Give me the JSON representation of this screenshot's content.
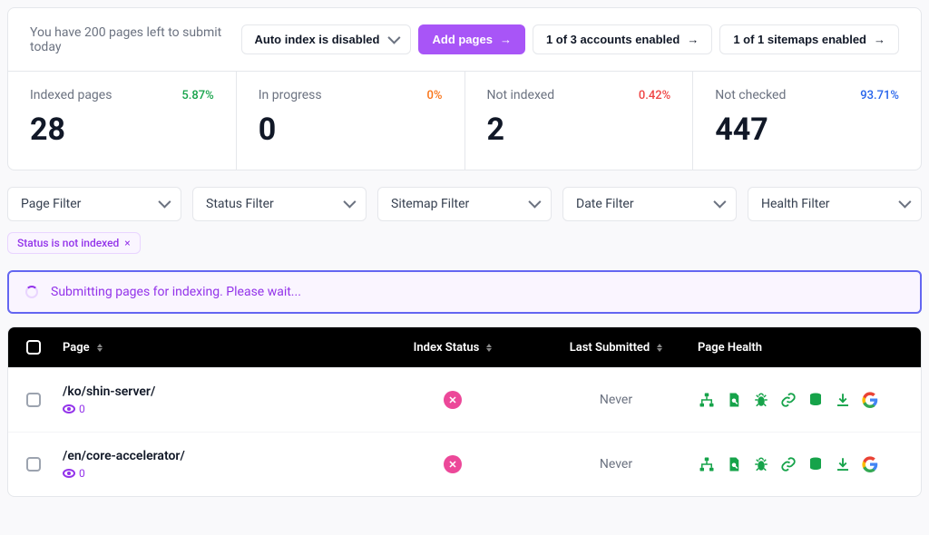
{
  "topbar": {
    "quota_msg": "You have 200 pages left to submit today",
    "auto_index_label": "Auto index is disabled",
    "add_pages_label": "Add pages",
    "accounts_label": "1 of 3 accounts enabled",
    "sitemaps_label": "1 of 1 sitemaps enabled"
  },
  "stats": {
    "indexed": {
      "label": "Indexed pages",
      "pct": "5.87%",
      "value": "28"
    },
    "in_progress": {
      "label": "In progress",
      "pct": "0%",
      "value": "0"
    },
    "not_indexed": {
      "label": "Not indexed",
      "pct": "0.42%",
      "value": "2"
    },
    "not_checked": {
      "label": "Not checked",
      "pct": "93.71%",
      "value": "447"
    }
  },
  "filters": {
    "page": "Page Filter",
    "status": "Status Filter",
    "sitemap": "Sitemap Filter",
    "date": "Date Filter",
    "health": "Health Filter"
  },
  "applied_chip": {
    "label": "Status is not indexed"
  },
  "banner": {
    "text": "Submitting pages for indexing. Please wait..."
  },
  "table": {
    "headers": {
      "page": "Page",
      "index_status": "Index Status",
      "last_submitted": "Last Submitted",
      "page_health": "Page Health"
    },
    "rows": [
      {
        "path": "/ko/shin-server/",
        "views": "0",
        "last": "Never"
      },
      {
        "path": "/en/core-accelerator/",
        "views": "0",
        "last": "Never"
      }
    ]
  },
  "health_icons": [
    "sitemap-tree-icon",
    "page-find-icon",
    "bug-icon",
    "link-icon",
    "database-icon",
    "download-icon",
    "google-icon"
  ]
}
